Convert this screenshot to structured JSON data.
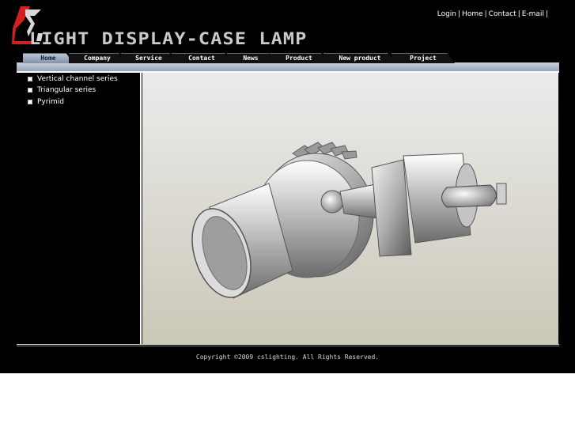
{
  "top_links": [
    "Login",
    "Home",
    "Contact",
    "E-mail"
  ],
  "logo": {
    "text": "LIGHT  DISPLAY-CASE  LAMP",
    "accent_color": "#d32020"
  },
  "nav": {
    "tabs": [
      {
        "label": "Home",
        "active": true
      },
      {
        "label": "Company",
        "active": false
      },
      {
        "label": "Service",
        "active": false
      },
      {
        "label": "Contact",
        "active": false
      },
      {
        "label": "News",
        "active": false
      },
      {
        "label": "Product",
        "active": false
      },
      {
        "label": "New product",
        "active": false
      },
      {
        "label": "Project",
        "active": false
      }
    ]
  },
  "sidebar": {
    "items": [
      {
        "label": "Vertical channel series"
      },
      {
        "label": "Triangular series"
      },
      {
        "label": "Pyrimid"
      }
    ]
  },
  "footer": {
    "copyright": "Copyright ©2009 cslighting. All Rights Reserved."
  }
}
